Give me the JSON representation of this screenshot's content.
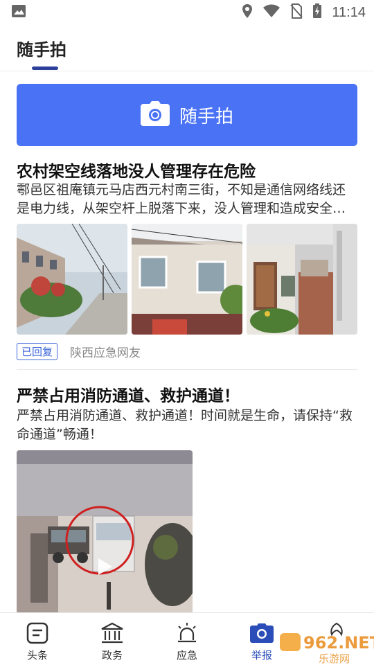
{
  "status_bar": {
    "time": "11:14",
    "icons": [
      "image-icon",
      "location-icon",
      "wifi-icon",
      "no-sim-icon",
      "battery-charging-icon"
    ]
  },
  "header": {
    "title": "随手拍"
  },
  "action_button": {
    "label": "随手拍",
    "icon": "camera-icon"
  },
  "posts": [
    {
      "title": "农村架空线落地没人管理存在危险",
      "description": "鄠邑区祖庵镇元马店西元村南三街，不知是通信网络线还是电力线，从架空杆上脱落下来，没人管理和造成安全隐患",
      "status_badge": "已回复",
      "author": "陕西应急网友",
      "images": [
        "village-road-photo",
        "building-wall-photo",
        "house-gate-photo"
      ]
    },
    {
      "title": "严禁占用消防通道、救护通道！",
      "description": "严禁占用消防通道、救护通道！时间就是生命，请保持“救命通道”畅通！",
      "video": "fire-lane-video",
      "video_icon": "play-icon"
    }
  ],
  "bottom_nav": {
    "items": [
      {
        "label": "头条",
        "icon": "news-icon",
        "active": false
      },
      {
        "label": "政务",
        "icon": "government-icon",
        "active": false
      },
      {
        "label": "应急",
        "icon": "alarm-icon",
        "active": false
      },
      {
        "label": "举报",
        "icon": "camera-icon",
        "active": true
      },
      {
        "label": "",
        "icon": "profile-icon",
        "active": false
      }
    ]
  },
  "watermark": {
    "text_top": "962.NET",
    "text_bottom": "乐游网"
  },
  "colors": {
    "primary": "#4a72f5",
    "accent": "#2b3f9b",
    "badge": "#3a63d8"
  }
}
